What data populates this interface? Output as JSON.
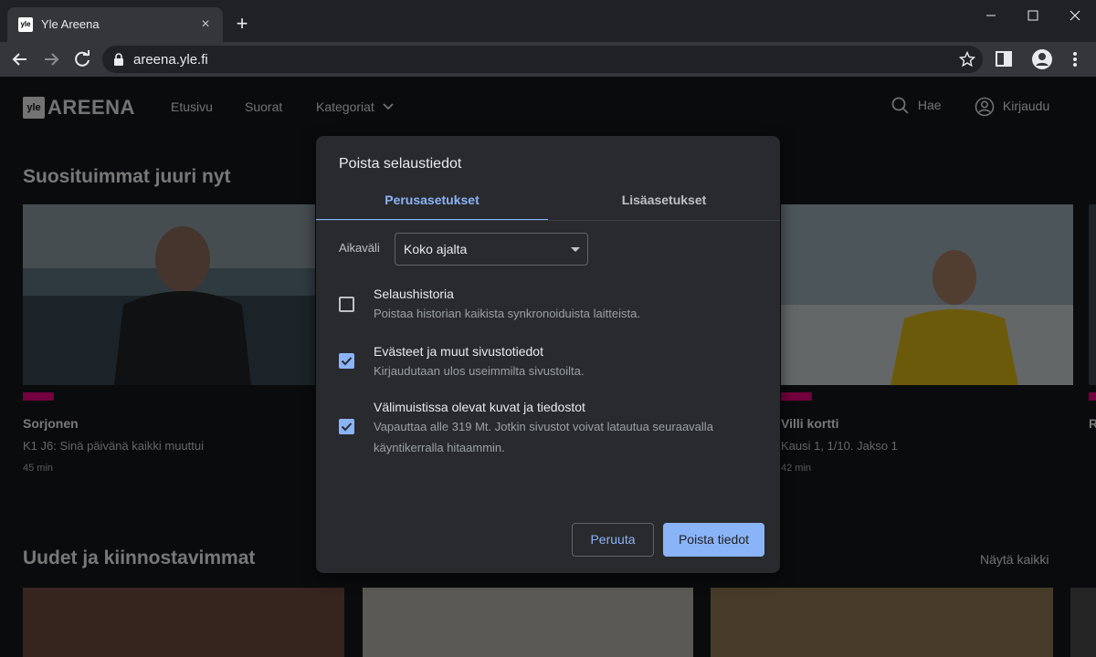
{
  "browser": {
    "tab_title": "Yle Areena",
    "tab_favicon": "yle",
    "url": "areena.yle.fi",
    "icons": [
      "back-icon",
      "forward-icon",
      "reload-icon",
      "lock-icon",
      "star-icon",
      "side-panel-icon",
      "profile-icon",
      "menu-icon",
      "close-icon",
      "plus-icon",
      "minimize-icon",
      "maximize-icon"
    ]
  },
  "site": {
    "logo_yle": "yle",
    "logo_areena": "AREENA",
    "nav": [
      "Etusivu",
      "Suorat",
      "Kategoriat"
    ],
    "search_label": "Hae",
    "login_label": "Kirjaudu",
    "section1_title": "Suosituimmat juuri nyt",
    "section2_title": "Uudet ja kiinnostavimmat",
    "show_all": "Näytä kaikki",
    "cards": [
      {
        "title": "Sorjonen",
        "subtitle": "K1 J6: Sinä päivänä kaikki muuttui",
        "duration": "45 min"
      },
      {
        "title": "Villi kortti",
        "subtitle": "Kausi 1, 1/10. Jakso 1",
        "duration": "42 min"
      },
      {
        "title": "R",
        "subtitle": "",
        "duration": ""
      }
    ],
    "accent_color": "#e6007e"
  },
  "dialog": {
    "title": "Poista selaustiedot",
    "tabs": [
      "Perusasetukset",
      "Lisäasetukset"
    ],
    "active_tab": "Perusasetukset",
    "range_label": "Aikaväli",
    "range_value": "Koko ajalta",
    "options": [
      {
        "title": "Selaushistoria",
        "description": "Poistaa historian kaikista synkronoiduista laitteista.",
        "checked": false
      },
      {
        "title": "Evästeet ja muut sivustotiedot",
        "description": "Kirjaudutaan ulos useimmilta sivustoilta.",
        "checked": true
      },
      {
        "title": "Välimuistissa olevat kuvat ja tiedostot",
        "description": "Vapauttaa alle 319 Mt. Jotkin sivustot voivat latautua seuraavalla käyntikerralla hitaammin.",
        "checked": true
      }
    ],
    "cancel_label": "Peruuta",
    "confirm_label": "Poista tiedot",
    "accent_color": "#8ab4f8"
  }
}
